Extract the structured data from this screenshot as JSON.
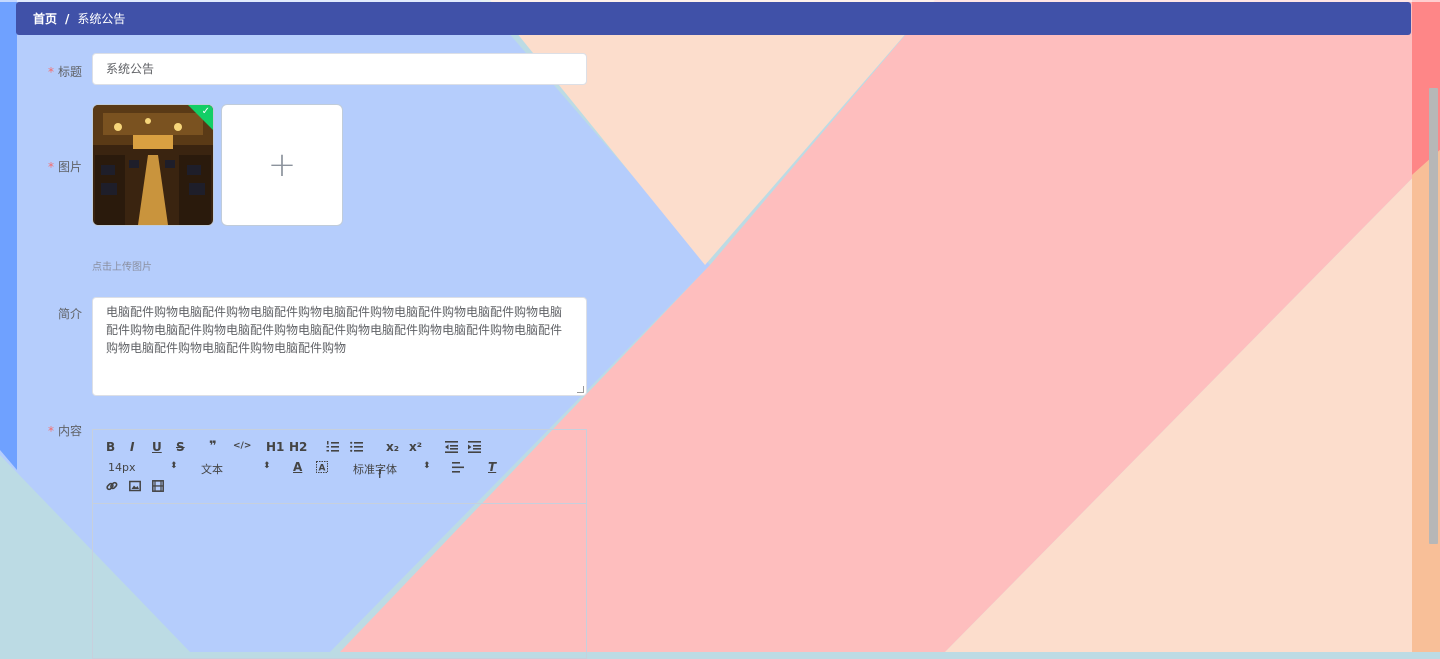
{
  "breadcrumb": {
    "home": "首页",
    "separator": "/",
    "current": "系统公告"
  },
  "form": {
    "title": {
      "label": "标题",
      "value": "系统公告"
    },
    "image": {
      "label": "图片",
      "upload_tip": "点击上传图片",
      "add_icon": "plus-icon"
    },
    "intro": {
      "label": "简介",
      "value": "电脑配件购物电脑配件购物电脑配件购物电脑配件购物电脑配件购物电脑配件购物电脑配件购物电脑配件购物电脑配件购物电脑配件购物电脑配件购物电脑配件购物电脑配件购物电脑配件购物电脑配件购物电脑配件购物"
    },
    "content": {
      "label": "内容"
    },
    "required_mark": "*"
  },
  "editor": {
    "toolbar_row1": [
      "B",
      "I",
      "U",
      "S",
      "❞",
      "</>",
      "H1",
      "H2",
      "ordered-list-icon",
      "bullet-list-icon",
      "x₂",
      "x²",
      "outdent-icon",
      "indent-icon"
    ],
    "size_select": "14px",
    "type_select": "文本",
    "font_select": "标准字体"
  },
  "colors": {
    "header_bg": "#4051a8",
    "required": "#f56c6c",
    "check": "#13ce66"
  }
}
